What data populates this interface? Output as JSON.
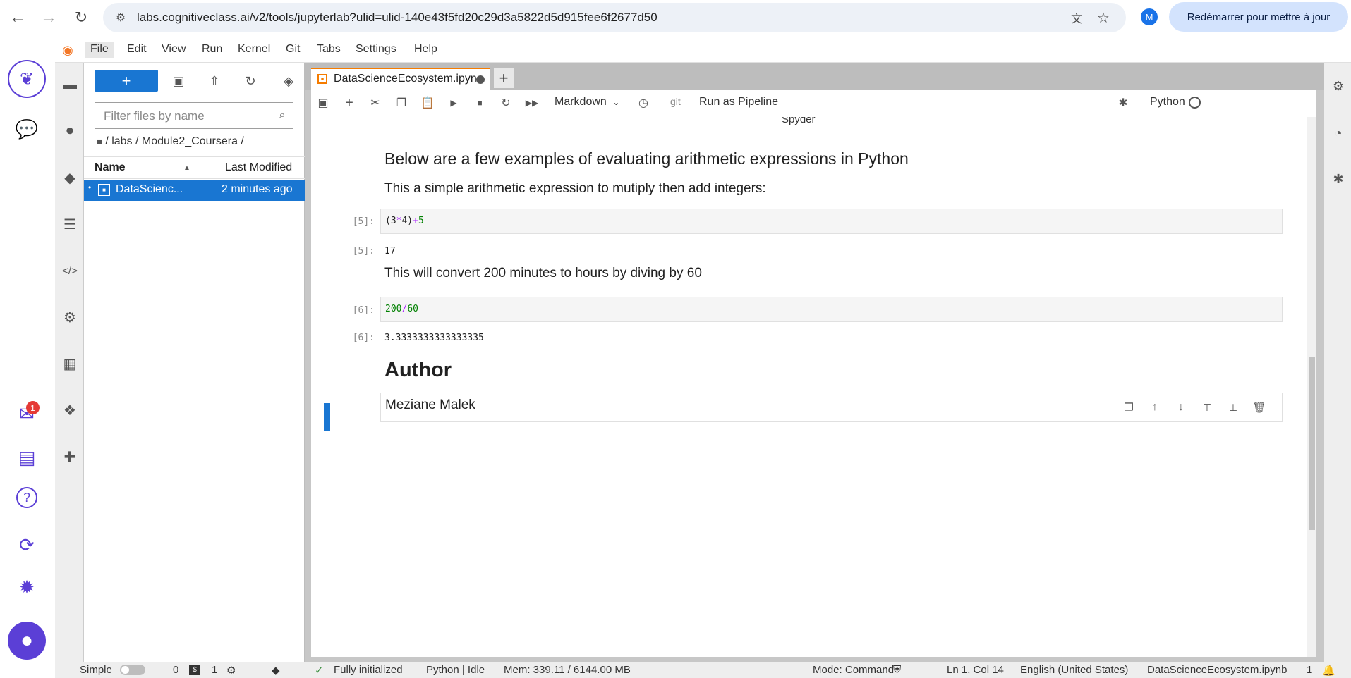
{
  "browser": {
    "url": "labs.cognitiveclass.ai/v2/tools/jupyterlab?ulid=ulid-140e43f5fd20c29d3a5822d5d915fee6f2677d50",
    "profile_initial": "M",
    "restart_label": "Redémarrer pour mettre à jour"
  },
  "menu": [
    "File",
    "Edit",
    "View",
    "Run",
    "Kernel",
    "Git",
    "Tabs",
    "Settings",
    "Help"
  ],
  "app_rail": {
    "notification_count": "1"
  },
  "file_browser": {
    "new_label": "+",
    "filter_placeholder": "Filter files by name",
    "breadcrumb": "/ labs / Module2_Coursera /",
    "col_name": "Name",
    "col_modified": "Last Modified",
    "files": [
      {
        "name": "DataScienc...",
        "modified": "2 minutes ago"
      }
    ]
  },
  "notebook": {
    "tab_title": "DataScienceEcosystem.ipyn",
    "cell_type": "Markdown",
    "git_label": "git",
    "pipeline_label": "Run as Pipeline",
    "kernel_name": "Python",
    "top_partial": "Spyder",
    "heading1": "Below are a few examples of evaluating arithmetic expressions in Python",
    "text1": "This a simple arithmetic expression to mutiply then add integers:",
    "cell5_prompt": "[5]:",
    "cell5_code_a": "(3",
    "cell5_code_op1": "*",
    "cell5_code_b": "4)",
    "cell5_code_op2": "+",
    "cell5_code_c": "5",
    "out5_prompt": "[5]:",
    "out5": "17",
    "text2": "This will convert 200 minutes to hours by diving by 60",
    "cell6_prompt": "[6]:",
    "cell6_code_a": "200",
    "cell6_code_op": "/",
    "cell6_code_b": "60",
    "out6_prompt": "[6]:",
    "out6": "3.3333333333333335",
    "author_heading": "Author",
    "author_name": "Meziane Malek"
  },
  "status": {
    "simple": "Simple",
    "count0": "0",
    "count1": "1",
    "init": "Fully initialized",
    "kernel": "Python | Idle",
    "mem": "Mem: 339.11 / 6144.00 MB",
    "mode": "Mode: Command",
    "position": "Ln 1, Col 14",
    "language": "English (United States)",
    "file": "DataScienceEcosystem.ipynb",
    "notif": "1"
  },
  "colors": {
    "accent": "#1976d2",
    "rail_icon": "#5b3fd6",
    "tab_dirty": "#f57c00",
    "code_number": "#008000",
    "code_operator": "#aa22ff"
  }
}
